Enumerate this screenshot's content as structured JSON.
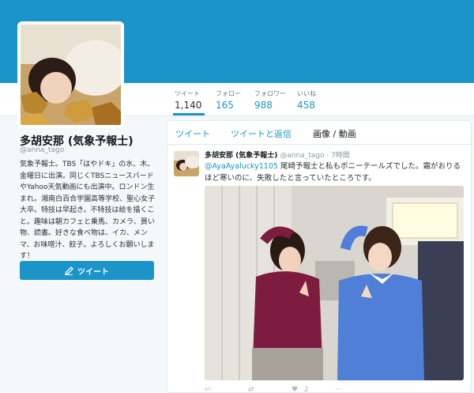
{
  "profile": {
    "name": "多胡安那 (気象予報士)",
    "handle": "@anna_tago",
    "bio": "気象予報士。TBS「はやドキ」の水、木、金曜日に出演。同じくTBSニュースバードやYahoo天気動画にも出演中。ロンドン生まれ。湘南白百合学園高等学校、聖心女子大卒。特技は早起き。不特技は絵を描くこと。趣味は朝カフェと乗馬、カメラ、買い物、読書。好きな食べ物は、イカ、メンマ、お味噌汁、餃子。よろしくお願いします！",
    "tweet_button": "ツイート"
  },
  "stats": [
    {
      "label": "ツイート",
      "value": "1,140"
    },
    {
      "label": "フォロー",
      "value": "165"
    },
    {
      "label": "フォロワー",
      "value": "988"
    },
    {
      "label": "いいね",
      "value": "458"
    }
  ],
  "tabs": [
    "ツイート",
    "ツイートと返信",
    "画像 / 動画"
  ],
  "tweet": {
    "name": "多胡安那 (気象予報士)",
    "handle": "@anna_tago",
    "time": "· 7時間",
    "mention": "@AyaAyalucky1105",
    "text": " 尾崎予報士と私もポニーテールズでした。霜がおりるほど寒いのに、失敗したと言っていたところです。",
    "retweets": "",
    "likes": "2"
  },
  "colors": {
    "accent": "#1b95c9",
    "banner": "#1b95c9"
  }
}
